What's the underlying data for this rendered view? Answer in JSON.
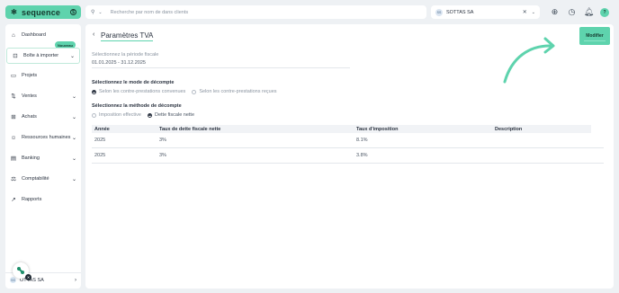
{
  "app": {
    "brand": "sequence",
    "brand_icon": "sequence-logo-icon",
    "currency_icon": "dollar-icon",
    "accent_color": "#5ed3ad"
  },
  "sidebar": {
    "new_badge": "Nouveau",
    "items": [
      {
        "label": "Dashboard",
        "icon": "home-icon",
        "has_chevron": false
      },
      {
        "label": "Boîte à importer",
        "icon": "inbox-icon",
        "has_chevron": true
      },
      {
        "label": "Projets",
        "icon": "folder-icon",
        "has_chevron": false
      },
      {
        "label": "Ventes",
        "icon": "sales-icon",
        "has_chevron": true
      },
      {
        "label": "Achats",
        "icon": "cart-icon",
        "has_chevron": true
      },
      {
        "label": "Ressources humaines",
        "icon": "people-icon",
        "has_chevron": true
      },
      {
        "label": "Banking",
        "icon": "bank-icon",
        "has_chevron": true
      },
      {
        "label": "Comptabilité",
        "icon": "ledger-icon",
        "has_chevron": true
      },
      {
        "label": "Rapports",
        "icon": "chart-icon",
        "has_chevron": false
      }
    ],
    "user": {
      "initials": "SS",
      "name": "OTTAS SA"
    }
  },
  "topbar": {
    "search_placeholder": "Recherche par nom de dans clients",
    "company": {
      "initials": "SS",
      "name": "SOTTAS SA"
    },
    "user_initial": "?"
  },
  "main": {
    "title": "Paramètres TVA",
    "modify_label": "Modifier",
    "period": {
      "label": "Sélectionnez la période fiscale",
      "value": "01.01.2025 - 31.12.2025"
    },
    "counting_mode": {
      "title": "Sélectionnez le mode de décompte",
      "options": [
        "Selon les contre-prestations convenues",
        "Selon les contre-prestations reçues"
      ],
      "selected_index": 0
    },
    "counting_method": {
      "title": "Sélectionnez la méthode de décompte",
      "options": [
        "Imposition effective",
        "Dette fiscale nette"
      ],
      "selected_index": 1
    },
    "table": {
      "columns": [
        "Année",
        "Taux de dette fiscale nette",
        "Taux d'imposition",
        "Description"
      ],
      "rows": [
        [
          "2025",
          "3%",
          "8.1%",
          ""
        ],
        [
          "2025",
          "3%",
          "3.8%",
          ""
        ]
      ]
    }
  }
}
